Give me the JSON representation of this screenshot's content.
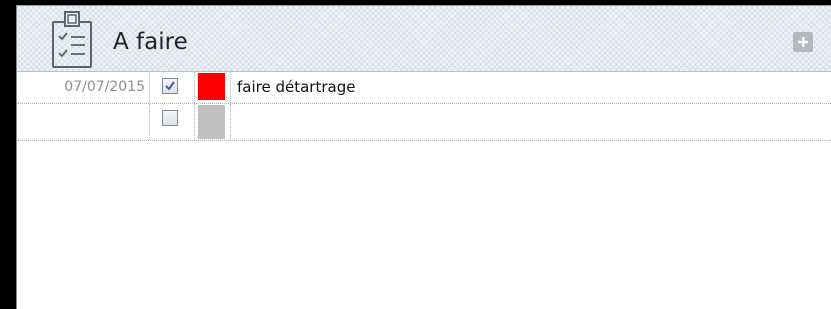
{
  "header": {
    "title": "A faire",
    "icon": "checklist-clipboard-icon",
    "add_icon": "plus-icon"
  },
  "tasks": [
    {
      "date": "07/07/2015",
      "checked": true,
      "color": "#ff0000",
      "text": "faire détartrage"
    },
    {
      "date": "",
      "checked": false,
      "color": "#c0c0c0",
      "text": ""
    }
  ],
  "colors": {
    "accent_red": "#ff0000",
    "empty_swatch": "#c0c0c0",
    "check_mark": "#3a5ea8"
  }
}
